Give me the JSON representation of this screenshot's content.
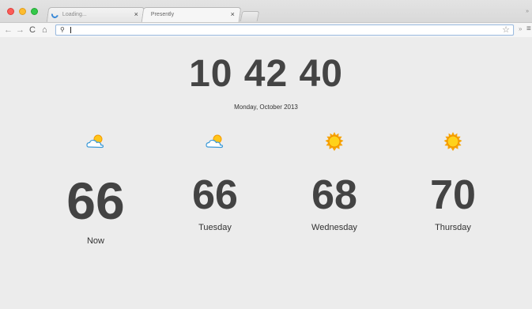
{
  "browser": {
    "tabs": [
      {
        "title": "Loading...",
        "close": "×",
        "loading": true
      },
      {
        "title": "Presently",
        "close": "×",
        "active": true
      }
    ],
    "toolbar": {
      "back": "←",
      "forward": "→",
      "reload": "C",
      "home": "⌂",
      "search_glyph": "⚲",
      "address_value": "",
      "bookmark": "☆",
      "overflow": "»",
      "menu": "≡"
    },
    "corner_glyph": "»"
  },
  "page": {
    "clock": "10 42 40",
    "date": "Monday, October 2013",
    "forecast": [
      {
        "label": "Now",
        "temp": "66",
        "icon": "partly-cloudy-icon"
      },
      {
        "label": "Tuesday",
        "temp": "66",
        "icon": "partly-cloudy-icon"
      },
      {
        "label": "Wednesday",
        "temp": "68",
        "icon": "sun-icon"
      },
      {
        "label": "Thursday",
        "temp": "70",
        "icon": "sun-icon"
      }
    ]
  },
  "colors": {
    "background": "#ececec",
    "text": "#444444",
    "sun": "#ffb300",
    "cloud_outline": "#3d9ad8"
  }
}
